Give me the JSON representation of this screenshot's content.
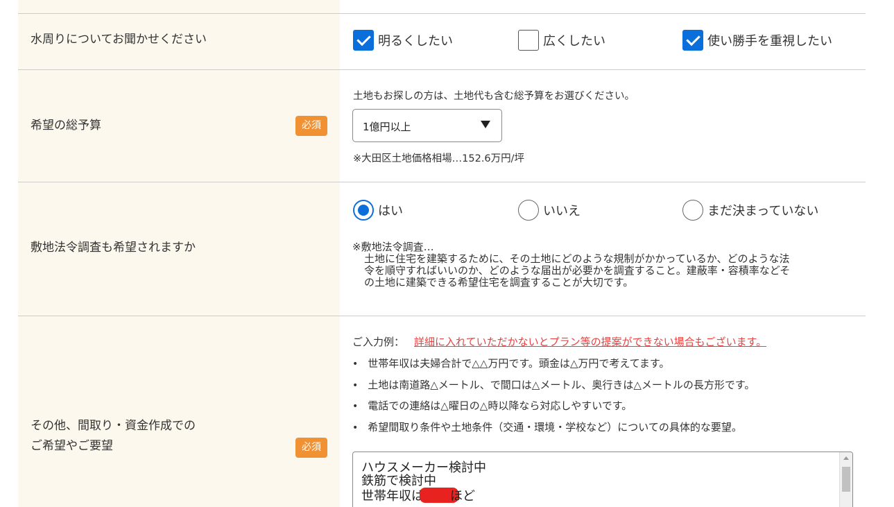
{
  "water": {
    "label": "水周りについてお聞かせください",
    "options": [
      {
        "label": "明るくしたい",
        "checked": true
      },
      {
        "label": "広くしたい",
        "checked": false
      },
      {
        "label": "使い勝手を重視したい",
        "checked": true
      }
    ]
  },
  "budget": {
    "label": "希望の総予算",
    "required": "必須",
    "note": "土地もお探しの方は、土地代も含む総予算をお選びください。",
    "selected": "1億円以上",
    "price_note": "※大田区土地価格相場…152.6万円/坪"
  },
  "survey": {
    "label": "敷地法令調査も希望されますか",
    "options": [
      {
        "label": "はい",
        "checked": true
      },
      {
        "label": "いいえ",
        "checked": false
      },
      {
        "label": "まだ決まっていない",
        "checked": false
      }
    ],
    "desc_title": "※敷地法令調査…",
    "desc_lines": [
      "土地に住宅を建築するために、その土地にどのような規制がかかっているか、どのような法",
      "令を順守すればいいのか、どのような届出が必要かを調査すること。建蔽率・容積率などそ",
      "の土地に建築できる希望住宅を調査することが大切です。"
    ]
  },
  "other": {
    "label_line1": "その他、間取り・資金作成での",
    "label_line2": "ご希望やご要望",
    "required": "必須",
    "example_prefix": "ご入力例：",
    "warning": "詳細に入れていただかないとプラン等の提案ができない場合もございます。",
    "bullets": [
      "世帯年収は夫婦合計で△△万円です。頭金は△万円で考えてます。",
      "土地は南道路△メートル、で間口は△メートル、奥行きは△メートルの長方形です。",
      "電話での連絡は△曜日の△時以降なら対応しやすいです。",
      "希望間取り条件や土地条件（交通・環境・学校など）についての具体的な要望。"
    ],
    "textarea_line1": "ハウスメーカー検討中",
    "textarea_line2": "鉄筋で検討中",
    "textarea_line3_prefix": "世帯年収は",
    "textarea_line3_suffix": "ほど"
  }
}
